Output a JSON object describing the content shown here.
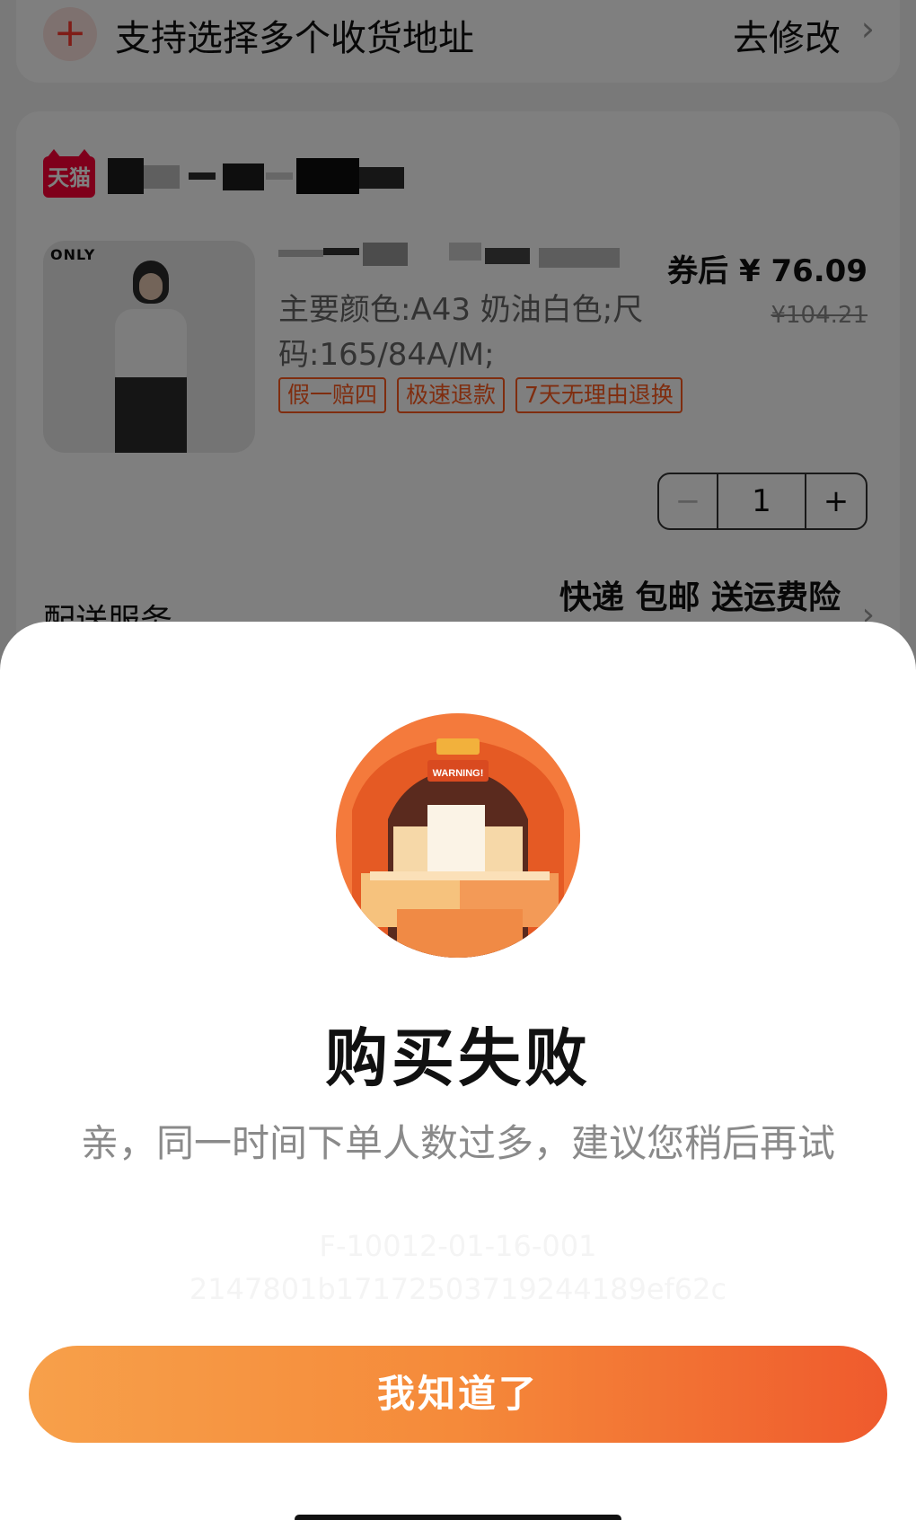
{
  "address": {
    "add_icon": "plus-icon",
    "text": "支持选择多个收货地址",
    "edit_label": "去修改",
    "chevron": "›"
  },
  "order": {
    "store_badge": "天猫",
    "product": {
      "brand": "ONLY",
      "spec": "主要颜色:A43 奶油白色;尺码:165/84A/M;",
      "price_after_coupon": "券后 ¥ 76.09",
      "price_original": "¥104.21",
      "tags": [
        "假一赔四",
        "极速退款",
        "7天无理由退换"
      ]
    },
    "quantity": {
      "minus": "−",
      "value": "1",
      "plus": "+"
    },
    "delivery": {
      "label": "配送服务",
      "value": "快递 包邮 送运费险",
      "chevron": "›"
    }
  },
  "dialog": {
    "illustration_label": "WARNING!",
    "title": "购买失败",
    "message": "亲，同一时间下单人数过多，建议您稍后再试",
    "error_code": "F-10012-01-16-001",
    "trace_id": "2147801b17172503719244189ef62c",
    "confirm_label": "我知道了"
  },
  "colors": {
    "accent_orange": "#f58a3a",
    "accent_red": "#ef5a2d",
    "tag_orange": "#ff5a1f",
    "tmall_red": "#ff0036"
  }
}
